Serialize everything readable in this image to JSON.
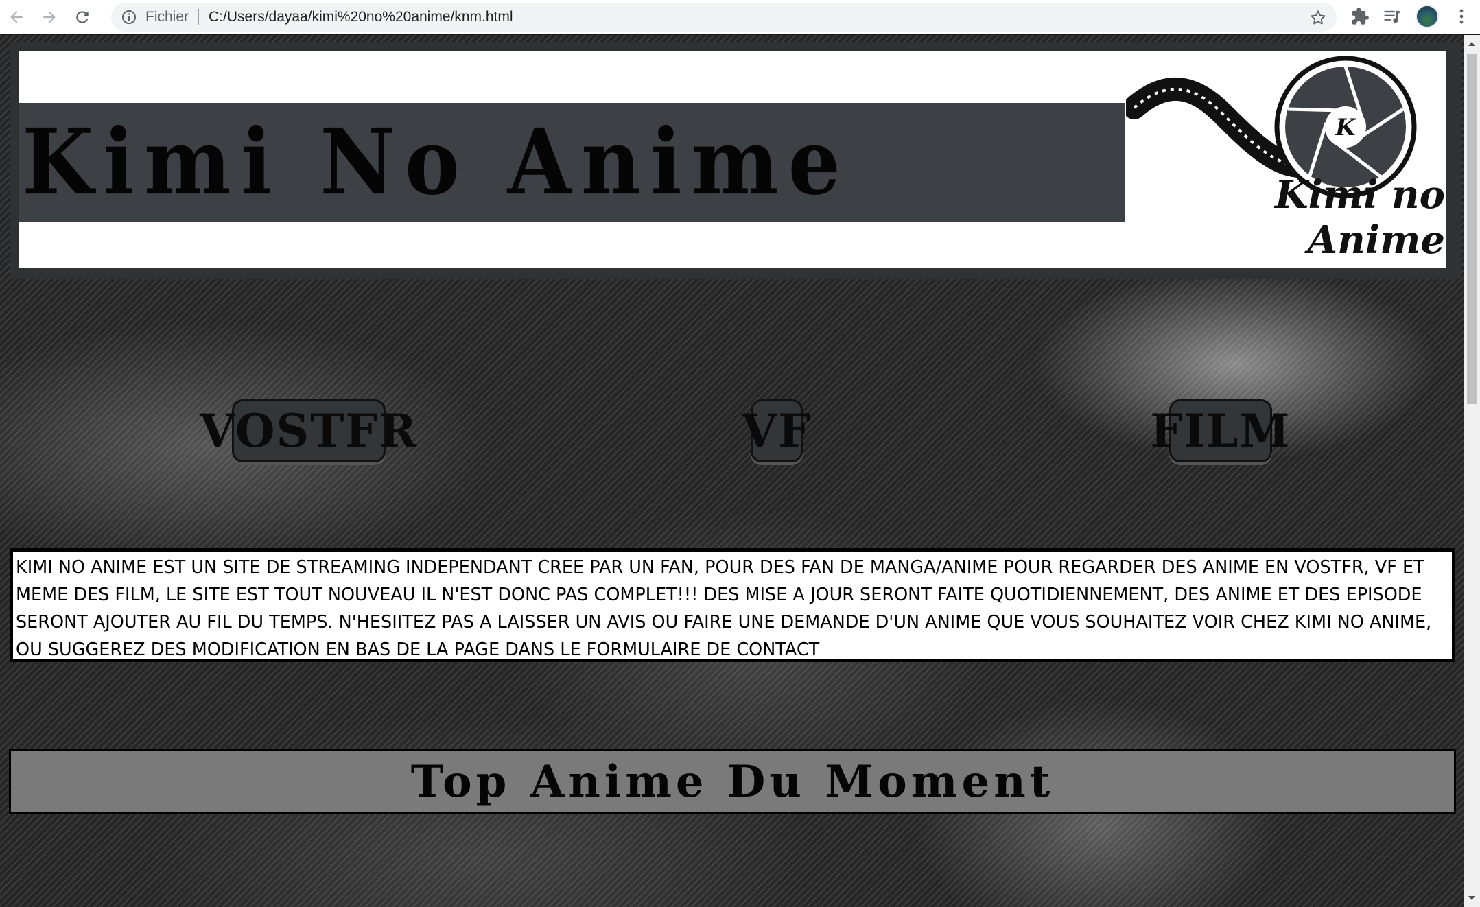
{
  "browser": {
    "scheme_label": "Fichier",
    "url": "C:/Users/dayaa/kimi%20no%20anime/knm.html"
  },
  "header": {
    "site_title": "Kimi No Anime",
    "logo_text": "Kimi no Anime",
    "logo_letter": "K"
  },
  "nav": {
    "vostfr": "VOSTFR",
    "vf": "VF",
    "film": "FILM"
  },
  "intro": {
    "text": "Kimi no anime est un site de streaming independant cree par un fan, pour des fan de manga/anime pour regarder des anime en vostfr, vf et meme des film, le site est tout nouveau il n'est donc pas complet!!! Des mise a jour seront faite quotidiennement, des anime et des episode seront ajouter au fil du temps. N'hesiitez pas a laisser un avis ou faire une demande d'un anime que vous souhaitez voir chez Kimi no Anime, ou suggerez des modification en bas de la page dans le formulaire de contact"
  },
  "top_section": {
    "title": "Top Anime Du Moment"
  },
  "colors": {
    "header_band": "#3d4145",
    "top_bar": "#7a7a7a",
    "button_bg": "#333638"
  }
}
